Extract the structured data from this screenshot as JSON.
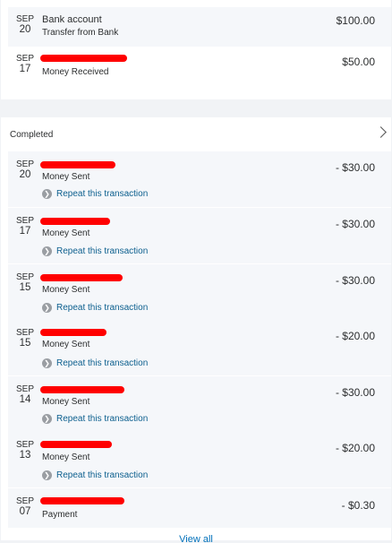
{
  "pending": [
    {
      "month": "SEP",
      "day": "20",
      "title": "Bank account",
      "subtitle": "Transfer from Bank",
      "amount": "$100.00",
      "redacted": false
    },
    {
      "month": "SEP",
      "day": "17",
      "title": "",
      "subtitle": "Money Received",
      "amount": "$50.00",
      "redacted": true
    }
  ],
  "completed": {
    "header": "Completed",
    "repeat_label": "Repeat this transaction",
    "items": [
      {
        "month": "SEP",
        "day": "20",
        "subtitle": "Money Sent",
        "amount": "- $30.00"
      },
      {
        "month": "SEP",
        "day": "17",
        "subtitle": "Money Sent",
        "amount": "- $30.00"
      },
      {
        "month": "SEP",
        "day": "15",
        "subtitle": "Money Sent",
        "amount": "- $30.00"
      },
      {
        "month": "SEP",
        "day": "15",
        "subtitle": "Money Sent",
        "amount": "- $20.00"
      },
      {
        "month": "SEP",
        "day": "14",
        "subtitle": "Money Sent",
        "amount": "- $30.00"
      },
      {
        "month": "SEP",
        "day": "13",
        "subtitle": "Money Sent",
        "amount": "- $20.00"
      }
    ],
    "last": {
      "month": "SEP",
      "day": "07",
      "subtitle": "Payment",
      "amount": "- $0.30"
    },
    "view_all": "View all"
  },
  "colors": {
    "link": "#0c5f8e",
    "redaction": "#ff0000",
    "row_bg": "#f5f7fa"
  }
}
